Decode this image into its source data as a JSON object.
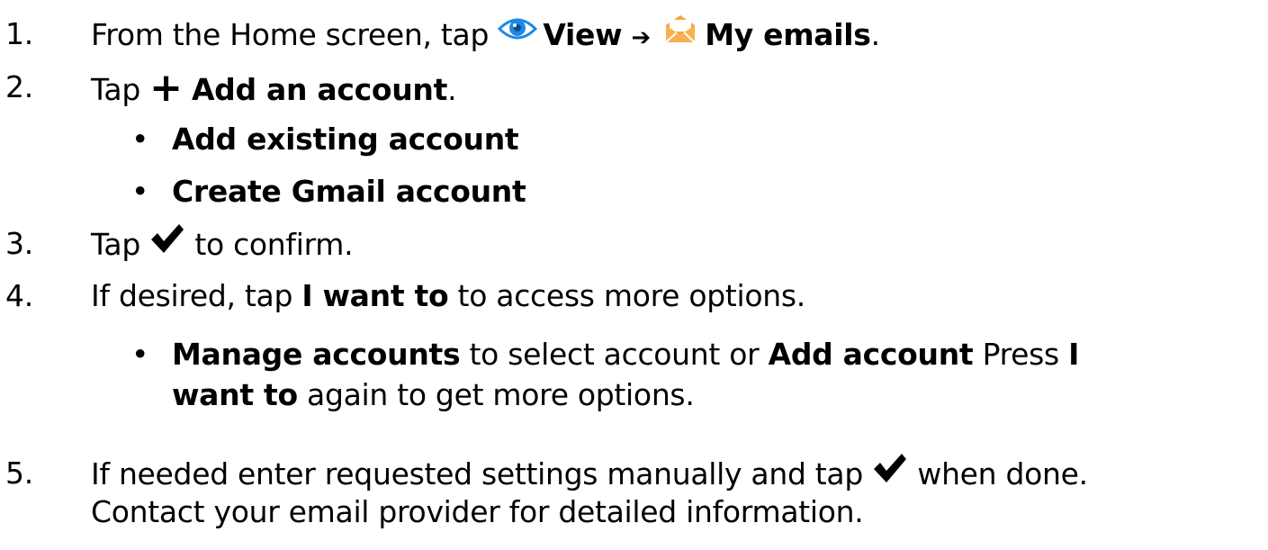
{
  "steps": [
    {
      "number": "1.",
      "prefix": "From the Home screen, tap ",
      "view_label": "View",
      "arrow": "➔",
      "emails_label": "My emails",
      "suffix": "."
    },
    {
      "number": "2.",
      "prefix": "Tap ",
      "plus": "+",
      "action": "Add an account",
      "suffix": ".",
      "options": [
        "Add existing account",
        "Create Gmail account"
      ]
    },
    {
      "number": "3.",
      "prefix": "Tap ",
      "suffix": " to confirm."
    },
    {
      "number": "4.",
      "prefix": "If desired, tap ",
      "action": "I want to",
      "suffix": " to access more options.",
      "sub": {
        "bold1": "Manage accounts",
        "mid": " to select account or ",
        "bold2": "Add account",
        "mid2": " Press ",
        "bold3a": "I",
        "bold3b": "want to",
        "end": " again to get more options."
      }
    },
    {
      "number": "5.",
      "prefix": "If needed enter requested settings manually and tap ",
      "suffix": " when done.",
      "line2": "Contact your email provider for detailed information."
    }
  ],
  "bullet": "•",
  "colors": {
    "eye_icon": "#1e88e5",
    "mail_icon": "#f5a53a",
    "text": "#000000"
  }
}
